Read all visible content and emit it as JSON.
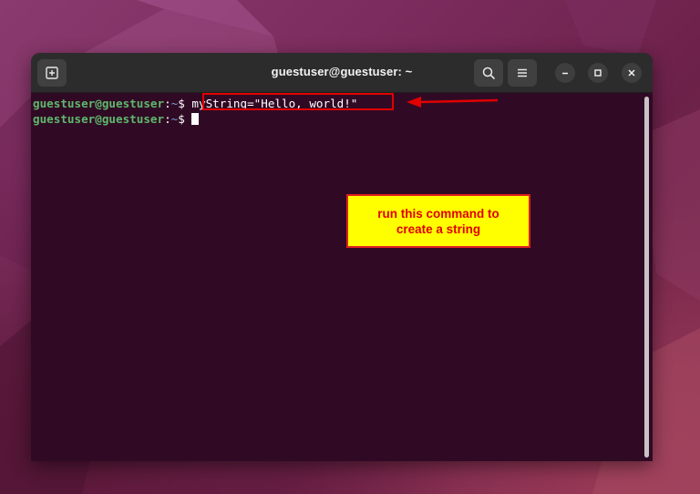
{
  "window": {
    "title": "guestuser@guestuser: ~"
  },
  "header_icons": {
    "new_tab": "new-tab-icon",
    "search": "search-icon",
    "menu": "hamburger-menu-icon",
    "minimize": "minimize-icon",
    "maximize": "maximize-icon",
    "close": "close-icon"
  },
  "terminal": {
    "lines": [
      {
        "user_host": "guestuser@guestuser",
        "separator": ":",
        "path": "~",
        "prompt_symbol": "$ ",
        "command": "myString=\"Hello, world!\""
      },
      {
        "user_host": "guestuser@guestuser",
        "separator": ":",
        "path": "~",
        "prompt_symbol": "$ ",
        "command": ""
      }
    ]
  },
  "annotation": {
    "callout_line1": "run this command to",
    "callout_line2": "create a string",
    "highlight_color": "#e00000",
    "callout_bg": "#ffff00"
  },
  "colors": {
    "terminal_bg": "#300a24",
    "headerbar_bg": "#2c2c2c",
    "prompt_user": "#5fb86d",
    "prompt_path": "#7a9ad8"
  }
}
